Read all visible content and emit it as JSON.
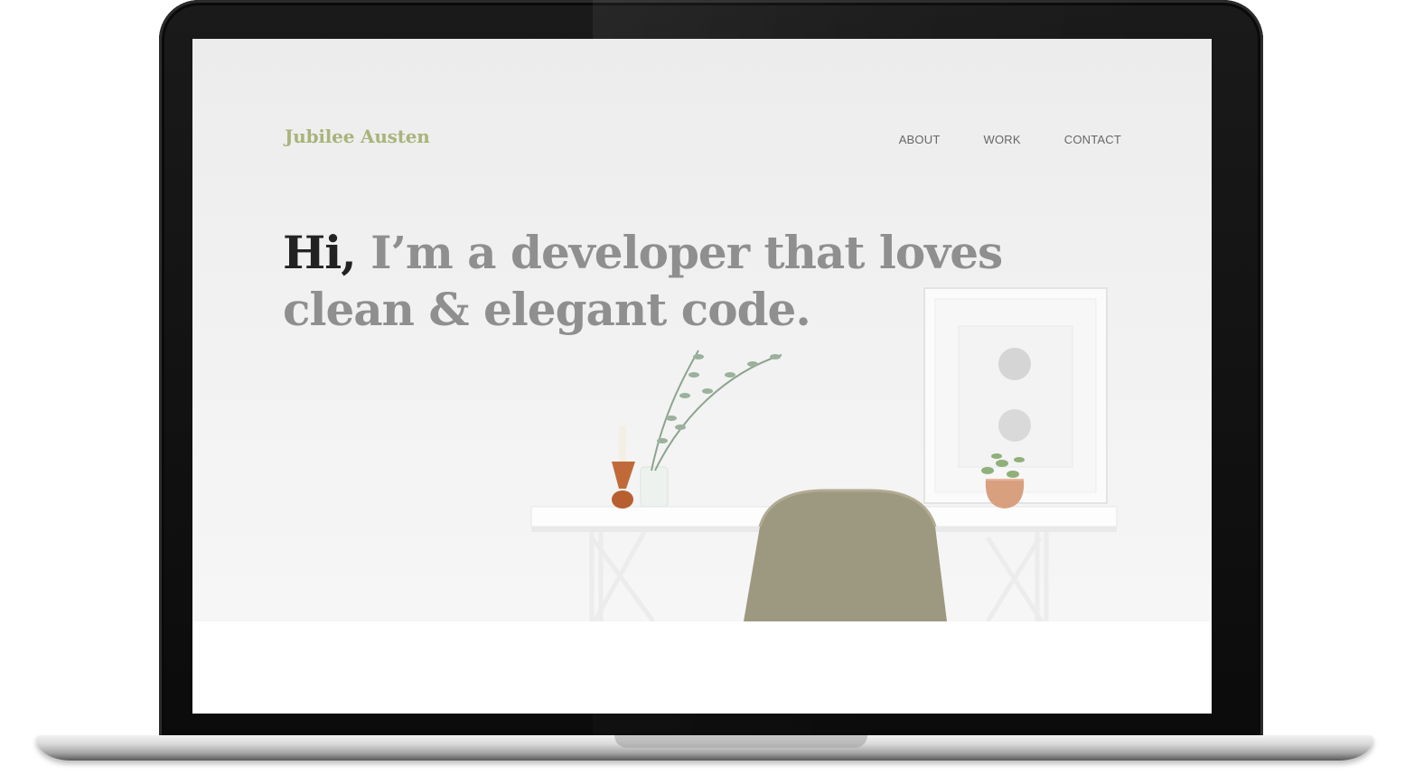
{
  "site": {
    "logo": "Jubilee Austen",
    "nav": [
      {
        "label": "ABOUT"
      },
      {
        "label": "WORK"
      },
      {
        "label": "CONTACT"
      }
    ]
  },
  "hero": {
    "greeting": "Hi,",
    "headline_rest": " I’m a developer that loves clean & elegant code."
  },
  "colors": {
    "logo": "#a8b47a",
    "headline": "#8f8f8f",
    "greeting": "#222222",
    "nav": "#666666"
  },
  "icons": {
    "scene": "desk-with-chair-plant-frame-illustration"
  }
}
